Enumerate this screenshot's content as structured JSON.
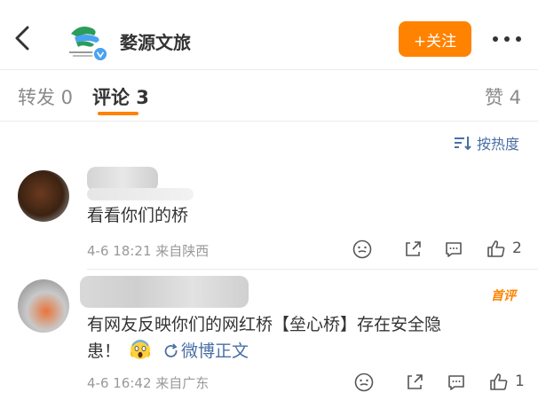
{
  "header": {
    "back_icon": "chevron-left-icon",
    "account_name": "婺源文旅",
    "follow_label": "+关注",
    "more_icon": "more-horizontal-icon",
    "logo_icon": "wuyuan-logo",
    "verified_icon": "verified-v-icon"
  },
  "tabs": [
    {
      "label": "转发 0",
      "active": false
    },
    {
      "label": "评论 3",
      "active": true
    },
    {
      "label": "赞 4",
      "active": false
    }
  ],
  "sort": {
    "label": "按热度",
    "icon": "sort-icon"
  },
  "comments": [
    {
      "text": "看看你们的桥",
      "meta": "4-6 18:21 来自陕西",
      "like_count": "2",
      "first_badge": ""
    },
    {
      "text_line1": "有网友反映你们的网红桥【垒心桥】存在安全隐",
      "text_line2": "患！",
      "emoji": "scream-emoji",
      "link_label": "微博正文",
      "meta": "4-6 16:42 来自广东",
      "like_count": "1",
      "first_badge": "首评"
    }
  ],
  "colors": {
    "accent": "#ff8200",
    "link": "#4a6fa5",
    "verified": "#4aa3f0"
  }
}
